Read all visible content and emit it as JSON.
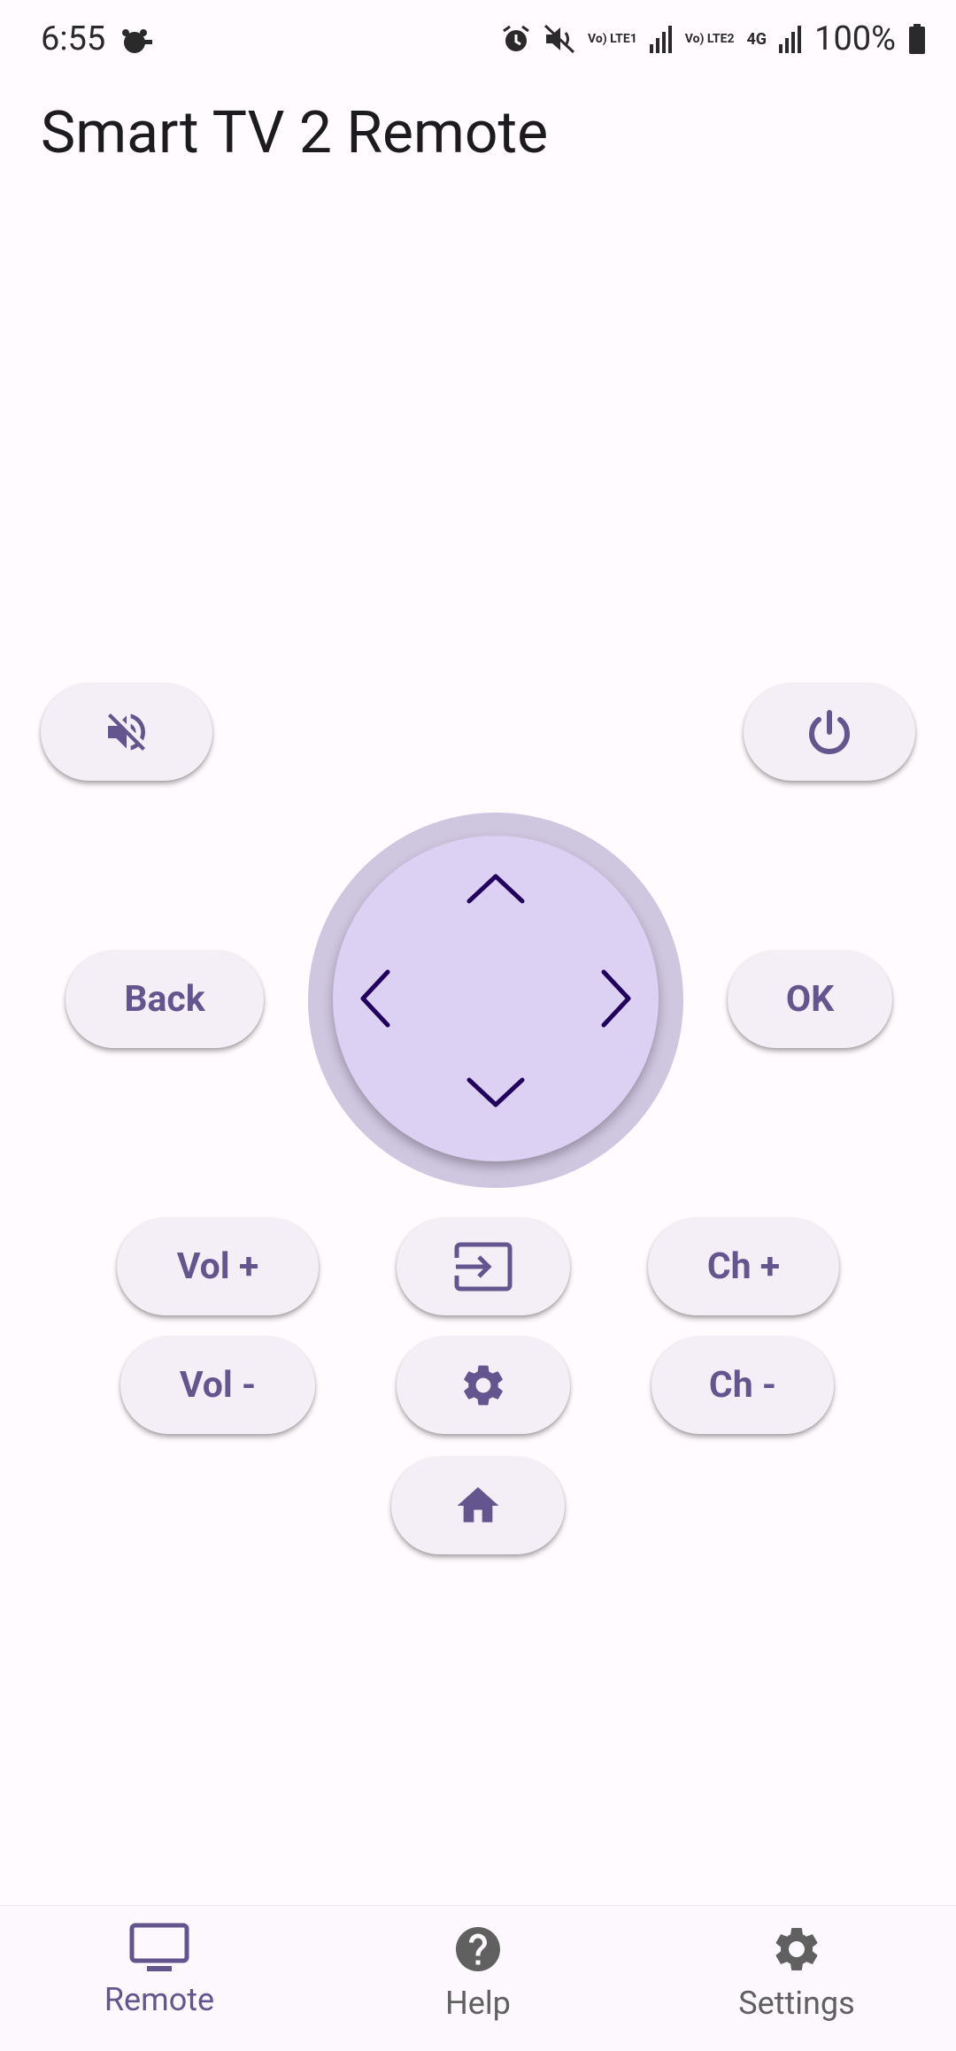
{
  "status_bar": {
    "time": "6:55",
    "battery": "100%",
    "sim1": "Vo) LTE1",
    "sim2": "Vo) LTE2",
    "network": "4G"
  },
  "app": {
    "title": "Smart TV 2 Remote"
  },
  "buttons": {
    "back": "Back",
    "ok": "OK",
    "vol_up": "Vol +",
    "vol_down": "Vol -",
    "ch_up": "Ch +",
    "ch_down": "Ch -"
  },
  "nav": {
    "items": [
      {
        "label": "Remote",
        "icon": "tv-icon",
        "active": true
      },
      {
        "label": "Help",
        "icon": "help-icon",
        "active": false
      },
      {
        "label": "Settings",
        "icon": "gear-icon",
        "active": false
      }
    ]
  },
  "colors": {
    "accent": "#65558f",
    "dpad": "#dcd0f3",
    "dpad_ring": "#cfc6e0",
    "background": "#fffbfe",
    "inactive_nav": "#606060"
  }
}
